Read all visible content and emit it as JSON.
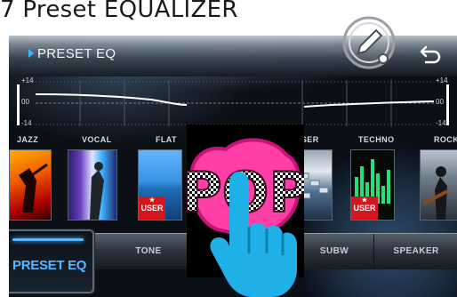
{
  "caption": "7 Preset EQUALIZER",
  "header": {
    "title": "PRESET EQ"
  },
  "eq_scale": {
    "top": "+14",
    "mid": "00",
    "bottom": "-14"
  },
  "presets": [
    {
      "name": "JAZZ",
      "user": false
    },
    {
      "name": "VOCAL",
      "user": false
    },
    {
      "name": "FLAT",
      "user": true
    },
    {
      "name": "POP",
      "user": false,
      "selected": true
    },
    {
      "name": "USER",
      "user": false
    },
    {
      "name": "TECHNO",
      "user": true
    },
    {
      "name": "ROCK",
      "user": false
    }
  ],
  "user_badge_text": "USER",
  "pop_art_text": "POP",
  "bottom_tabs": [
    "PRESET EQ",
    "TONE",
    "SUBW",
    "SPEAKER"
  ],
  "colors": {
    "accent": "#58b6ff",
    "user_badge": "#d4171f",
    "pop_pink": "#ff3fa5",
    "hand": "#1fb0e8"
  }
}
